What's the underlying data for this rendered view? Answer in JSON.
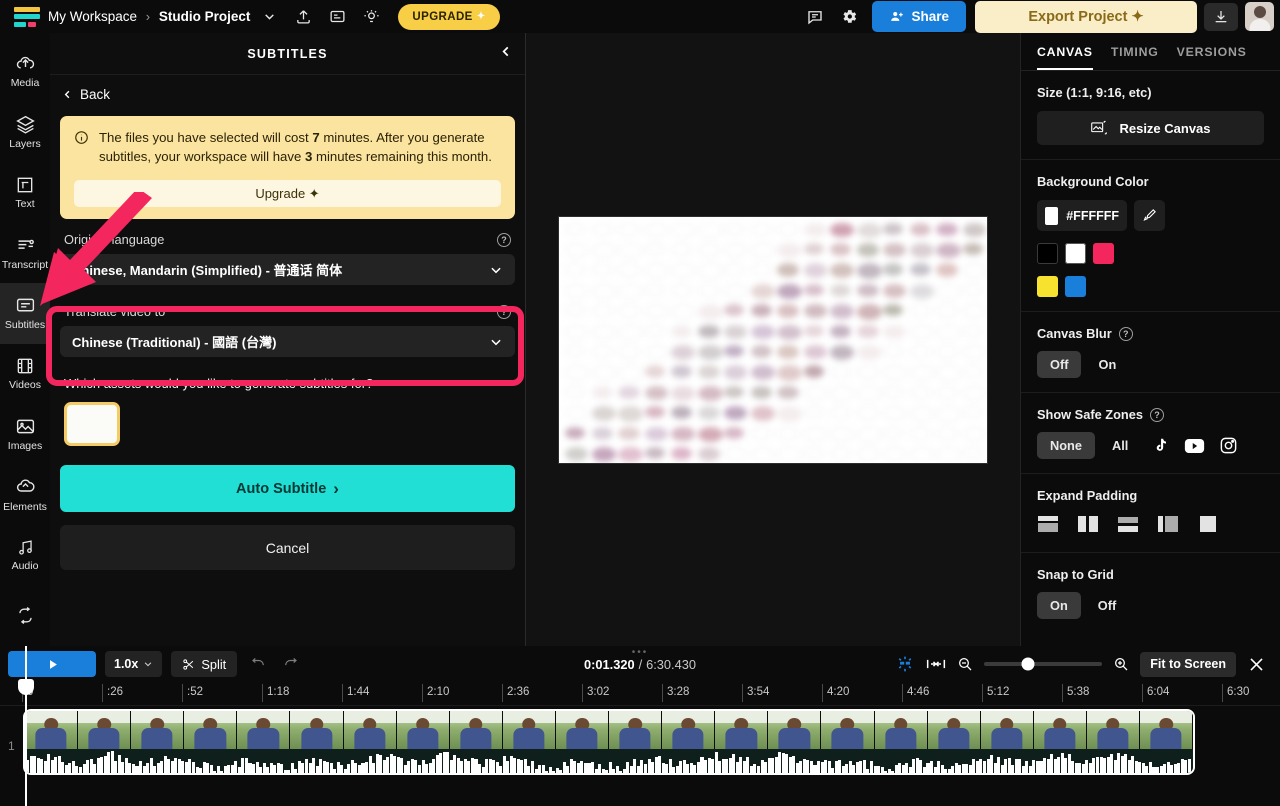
{
  "topbar": {
    "workspace": "My Workspace",
    "separator": "›",
    "project": "Studio Project",
    "upgrade_label": "UPGRADE",
    "upgrade_spark": "✦",
    "share_label": "Share",
    "export_label": "Export Project ✦",
    "icons": {
      "logo": "logo-icon",
      "chevron_project": "chevron-down-icon",
      "upload": "upload-icon",
      "captions": "captions-icon",
      "idea": "lightbulb-icon",
      "comment": "comment-icon",
      "settings": "gear-icon",
      "share": "add-person-icon",
      "download": "download-icon",
      "avatar": "user-avatar"
    }
  },
  "rail": {
    "items": [
      {
        "label": "Media",
        "icon": "cloud-upload-icon",
        "active": false
      },
      {
        "label": "Layers",
        "icon": "layers-icon",
        "active": false
      },
      {
        "label": "Text",
        "icon": "text-edit-icon",
        "active": false
      },
      {
        "label": "Transcript",
        "icon": "transcript-icon",
        "active": false
      },
      {
        "label": "Subtitles",
        "icon": "subtitles-icon",
        "active": true
      },
      {
        "label": "Videos",
        "icon": "film-icon",
        "active": false
      },
      {
        "label": "Images",
        "icon": "image-icon",
        "active": false
      },
      {
        "label": "Elements",
        "icon": "elements-icon",
        "active": false
      },
      {
        "label": "Audio",
        "icon": "music-note-icon",
        "active": false
      }
    ],
    "bottom_icon": "loop-icon"
  },
  "panel": {
    "title": "SUBTITLES",
    "collapse_icon": "chevron-left-icon",
    "back_label": "Back",
    "notice": {
      "text_1": "The files you have selected will cost ",
      "cost_minutes": "7",
      "text_2": " minutes. After you generate subtitles, your workspace will have ",
      "remaining_minutes": "3",
      "text_3": " minutes remaining this month.",
      "upgrade_label": "Upgrade ✦",
      "icon": "info-icon"
    },
    "original_language": {
      "label": "Original language",
      "value": "Chinese, Mandarin (Simplified) - 普通话 简体",
      "help_icon": "help-circle-icon",
      "chevron": "chevron-down-icon"
    },
    "translate_to": {
      "label": "Translate video to",
      "value": "Chinese (Traditional) - 國語 (台灣)",
      "help_icon": "help-circle-icon",
      "chevron": "chevron-down-icon"
    },
    "assets_question": "Which assets would you like to generate subtitles for?",
    "auto_subtitle_label": "Auto Subtitle",
    "auto_subtitle_chevron": "›",
    "cancel_label": "Cancel"
  },
  "annotation": {
    "highlight_color": "#f4265e",
    "arrow_color": "#f4265e",
    "arrow_target": "subtitles-sidebar-item"
  },
  "right_panel": {
    "tabs": [
      {
        "label": "CANVAS",
        "active": true
      },
      {
        "label": "TIMING",
        "active": false
      },
      {
        "label": "VERSIONS",
        "active": false
      }
    ],
    "size_section": {
      "title": "Size (1:1, 9:16, etc)",
      "resize_label": "Resize Canvas",
      "resize_icon": "resize-canvas-icon"
    },
    "background_color": {
      "title": "Background Color",
      "hex": "#FFFFFF",
      "picker_icon": "eyedropper-icon",
      "swatches": [
        "#000000",
        "#FFFFFF",
        "#F4265E",
        "#F7E230",
        "#1A7FDB"
      ]
    },
    "canvas_blur": {
      "title": "Canvas Blur",
      "help_icon": "help-circle-icon",
      "options": [
        "Off",
        "On"
      ],
      "selected": "Off"
    },
    "safe_zones": {
      "title": "Show Safe Zones",
      "help_icon": "help-circle-icon",
      "options": [
        "None",
        "All"
      ],
      "selected": "None",
      "platform_icons": [
        "tiktok-icon",
        "youtube-icon",
        "instagram-icon"
      ]
    },
    "expand_padding": {
      "title": "Expand Padding",
      "icons": [
        "pad-top-icon",
        "pad-left-right-icon",
        "pad-bottom-icon",
        "pad-left-icon",
        "pad-none-icon"
      ]
    },
    "snap_to_grid": {
      "title": "Snap to Grid",
      "options": [
        "On",
        "Off"
      ],
      "selected": "On"
    }
  },
  "timeline": {
    "play_icon": "play-icon",
    "speed": "1.0x",
    "speed_chevron": "chevron-down-icon",
    "split_label": "Split",
    "split_icon": "scissors-icon",
    "undo_icon": "undo-icon",
    "redo_icon": "redo-icon",
    "current_time": "0:01.320",
    "time_divider": "/",
    "total_time": "6:30.430",
    "magnet_icon": "magnet-snap-icon",
    "fit_icon": "fit-selection-icon",
    "zoom_out_icon": "zoom-out-icon",
    "zoom_in_icon": "zoom-in-icon",
    "fit_label": "Fit to Screen",
    "close_icon": "close-icon",
    "ruler_ticks": [
      "0",
      ":26",
      ":52",
      "1:18",
      "1:44",
      "2:10",
      "2:36",
      "3:02",
      "3:28",
      "3:54",
      "4:20",
      "4:46",
      "5:12",
      "5:38",
      "6:04",
      "6:30"
    ],
    "track_number": "1"
  }
}
